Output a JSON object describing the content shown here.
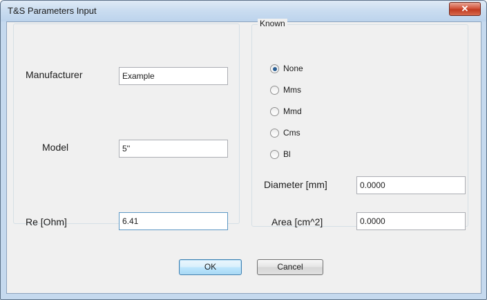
{
  "window": {
    "title": "T&S Parameters Input",
    "close_glyph": "✕"
  },
  "left_group": {
    "fields": [
      {
        "label": "Manufacturer",
        "value": "Example"
      },
      {
        "label": "Model",
        "value": "5''"
      },
      {
        "label": "Re [Ohm]",
        "value": "6.41"
      }
    ]
  },
  "known": {
    "title": "Known",
    "options": [
      {
        "label": "None",
        "checked": true
      },
      {
        "label": "Mms",
        "checked": false
      },
      {
        "label": "Mmd",
        "checked": false
      },
      {
        "label": "Cms",
        "checked": false
      },
      {
        "label": "Bl",
        "checked": false
      }
    ],
    "diameter": {
      "label": "Diameter [mm]",
      "value": "0.0000"
    },
    "area": {
      "label": "Area [cm^2]",
      "value": "0.0000"
    }
  },
  "buttons": {
    "ok": "OK",
    "cancel": "Cancel"
  }
}
